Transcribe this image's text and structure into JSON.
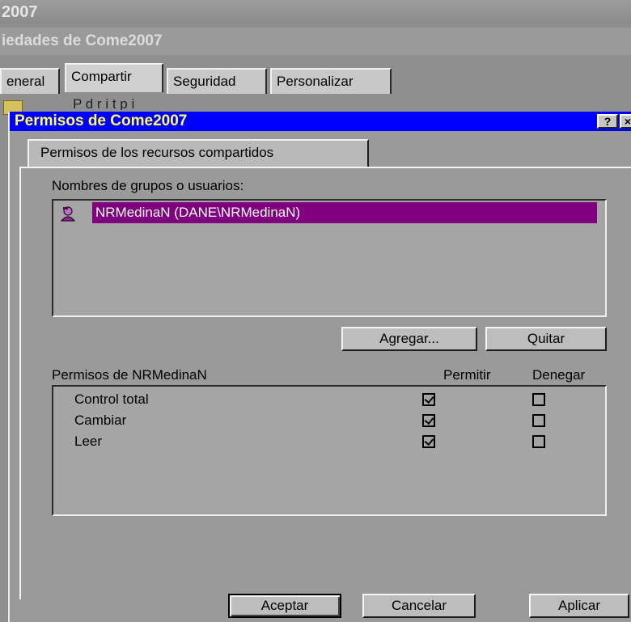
{
  "background_window": {
    "title_top": "2007",
    "title": "iedades de Come2007",
    "tabs": [
      "eneral",
      "Compartir",
      "Seguridad",
      "Personalizar"
    ],
    "partial_text": "P        d              r    i                              t                  p        i"
  },
  "dialog": {
    "title": "Permisos de Come2007",
    "help_label": "?",
    "close_label": "×",
    "tab_label": "Permisos de los recursos compartidos",
    "users_label": "Nombres de grupos o usuarios:",
    "users": [
      {
        "name": "NRMedinaN (DANE\\NRMedinaN)",
        "selected": true,
        "icon": "user-icon"
      }
    ],
    "add_button": "Agregar...",
    "remove_button": "Quitar",
    "perms_label": "Permisos de NRMedinaN",
    "allow_header": "Permitir",
    "deny_header": "Denegar",
    "permissions": [
      {
        "name": "Control total",
        "allow": true,
        "deny": false
      },
      {
        "name": "Cambiar",
        "allow": true,
        "deny": false
      },
      {
        "name": "Leer",
        "allow": true,
        "deny": false
      }
    ],
    "ok_button": "Aceptar",
    "cancel_button": "Cancelar",
    "apply_button": "Aplicar"
  },
  "colors": {
    "titlebar": "#0000ff",
    "title_text": "#ffff55",
    "selection": "#800080"
  }
}
